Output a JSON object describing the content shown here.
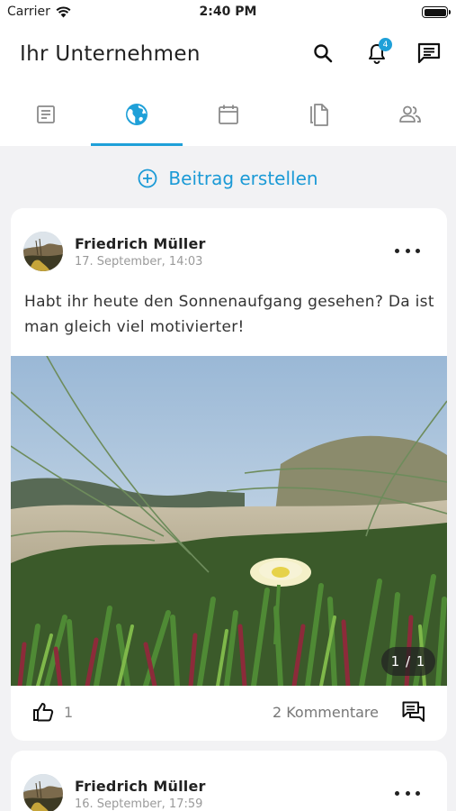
{
  "status_bar": {
    "carrier": "Carrier",
    "time": "2:40 PM",
    "battery_level": 1.0
  },
  "header": {
    "title": "Ihr Unternehmen",
    "notification_badge": "4"
  },
  "tabs": [
    {
      "icon": "newspaper-icon",
      "active": false
    },
    {
      "icon": "globe-icon",
      "active": true
    },
    {
      "icon": "calendar-icon",
      "active": false
    },
    {
      "icon": "documents-icon",
      "active": false
    },
    {
      "icon": "people-icon",
      "active": false
    }
  ],
  "create_post": {
    "label": "Beitrag erstellen"
  },
  "colors": {
    "accent": "#1fa0d8",
    "background": "#f2f2f4"
  },
  "posts": [
    {
      "author": "Friedrich Müller",
      "date": "17. September, 14:03",
      "text": "Habt ihr heute den Sonnenaufgang gesehen? Da ist man gleich viel motivierter!",
      "image_counter": "1 / 1",
      "likes": "1",
      "comments": "2 Kommentare"
    },
    {
      "author": "Friedrich Müller",
      "date": "16. September, 17:59"
    }
  ]
}
